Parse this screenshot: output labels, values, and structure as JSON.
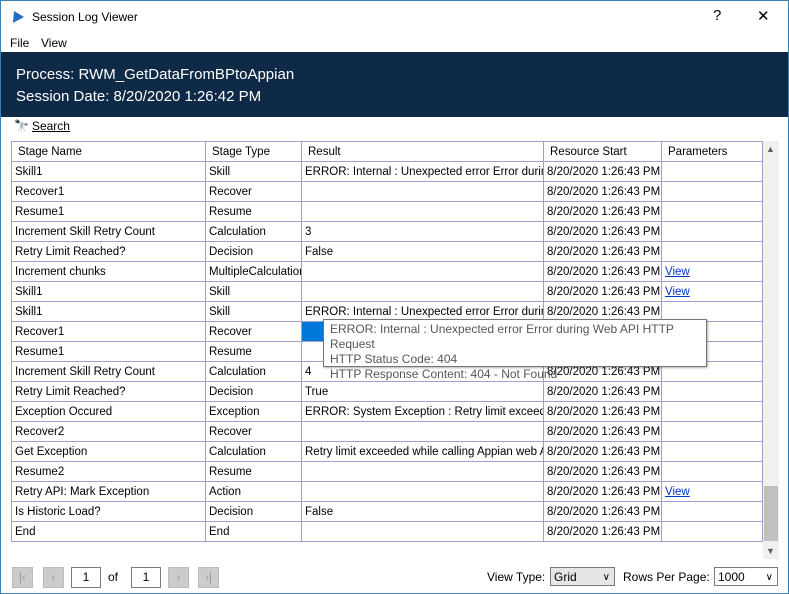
{
  "window": {
    "title": "Session Log Viewer",
    "help": "?",
    "close": "✕",
    "accent": "#0f2a47"
  },
  "menu": [
    "File",
    "View"
  ],
  "banner": {
    "process": "Process: RWM_GetDataFromBPtoAppian",
    "session_date": "Session Date: 8/20/2020 1:26:42 PM"
  },
  "search": {
    "label": "Search"
  },
  "grid": {
    "columns": [
      "Stage Name",
      "Stage Type",
      "Result",
      "Resource Start",
      "Parameters"
    ],
    "rows": [
      [
        "Skill1",
        "Skill",
        "ERROR: Internal : Unexpected error Error durin...",
        "8/20/2020 1:26:43 PM",
        ""
      ],
      [
        "Recover1",
        "Recover",
        "",
        "8/20/2020 1:26:43 PM",
        ""
      ],
      [
        "Resume1",
        "Resume",
        "",
        "8/20/2020 1:26:43 PM",
        ""
      ],
      [
        "Increment Skill Retry Count",
        "Calculation",
        "3",
        "8/20/2020 1:26:43 PM",
        ""
      ],
      [
        "Retry Limit Reached?",
        "Decision",
        "False",
        "8/20/2020 1:26:43 PM",
        ""
      ],
      [
        "Increment chunks",
        "MultipleCalculation",
        "",
        "8/20/2020 1:26:43 PM",
        "View"
      ],
      [
        "Skill1",
        "Skill",
        "",
        "8/20/2020 1:26:43 PM",
        "View"
      ],
      [
        "Skill1",
        "Skill",
        "ERROR: Internal : Unexpected error Error durin...",
        "8/20/2020 1:26:43 PM",
        ""
      ],
      [
        "Recover1",
        "Recover",
        "",
        "8/20/2020 1:26:43 PM",
        ""
      ],
      [
        "Resume1",
        "Resume",
        "",
        "8/20/2020 1:26:43 PM",
        ""
      ],
      [
        "Increment Skill Retry Count",
        "Calculation",
        "4",
        "8/20/2020 1:26:43 PM",
        ""
      ],
      [
        "Retry Limit Reached?",
        "Decision",
        "True",
        "8/20/2020 1:26:43 PM",
        ""
      ],
      [
        "Exception Occured",
        "Exception",
        "ERROR: System Exception : Retry limit exceed...",
        "8/20/2020 1:26:43 PM",
        ""
      ],
      [
        "Recover2",
        "Recover",
        "",
        "8/20/2020 1:26:43 PM",
        ""
      ],
      [
        "Get Exception",
        "Calculation",
        "Retry limit exceeded while calling Appian web A...",
        "8/20/2020 1:26:43 PM",
        ""
      ],
      [
        "Resume2",
        "Resume",
        "",
        "8/20/2020 1:26:43 PM",
        ""
      ],
      [
        "Retry API: Mark Exception",
        "Action",
        "",
        "8/20/2020 1:26:43 PM",
        "View"
      ],
      [
        "Is Historic Load?",
        "Decision",
        "False",
        "8/20/2020 1:26:43 PM",
        ""
      ],
      [
        "End",
        "End",
        "",
        "8/20/2020 1:26:43 PM",
        ""
      ]
    ]
  },
  "tooltip": [
    "ERROR: Internal : Unexpected error Error during Web API HTTP Request",
    "HTTP Status Code: 404",
    "HTTP Response Content: 404 - Not Found"
  ],
  "pager": {
    "page": "1",
    "of": "of",
    "total": "1",
    "view_type_label": "View Type:",
    "view_type": "Grid",
    "rows_per_page_label": "Rows Per Page:",
    "rows_per_page": "1000"
  }
}
